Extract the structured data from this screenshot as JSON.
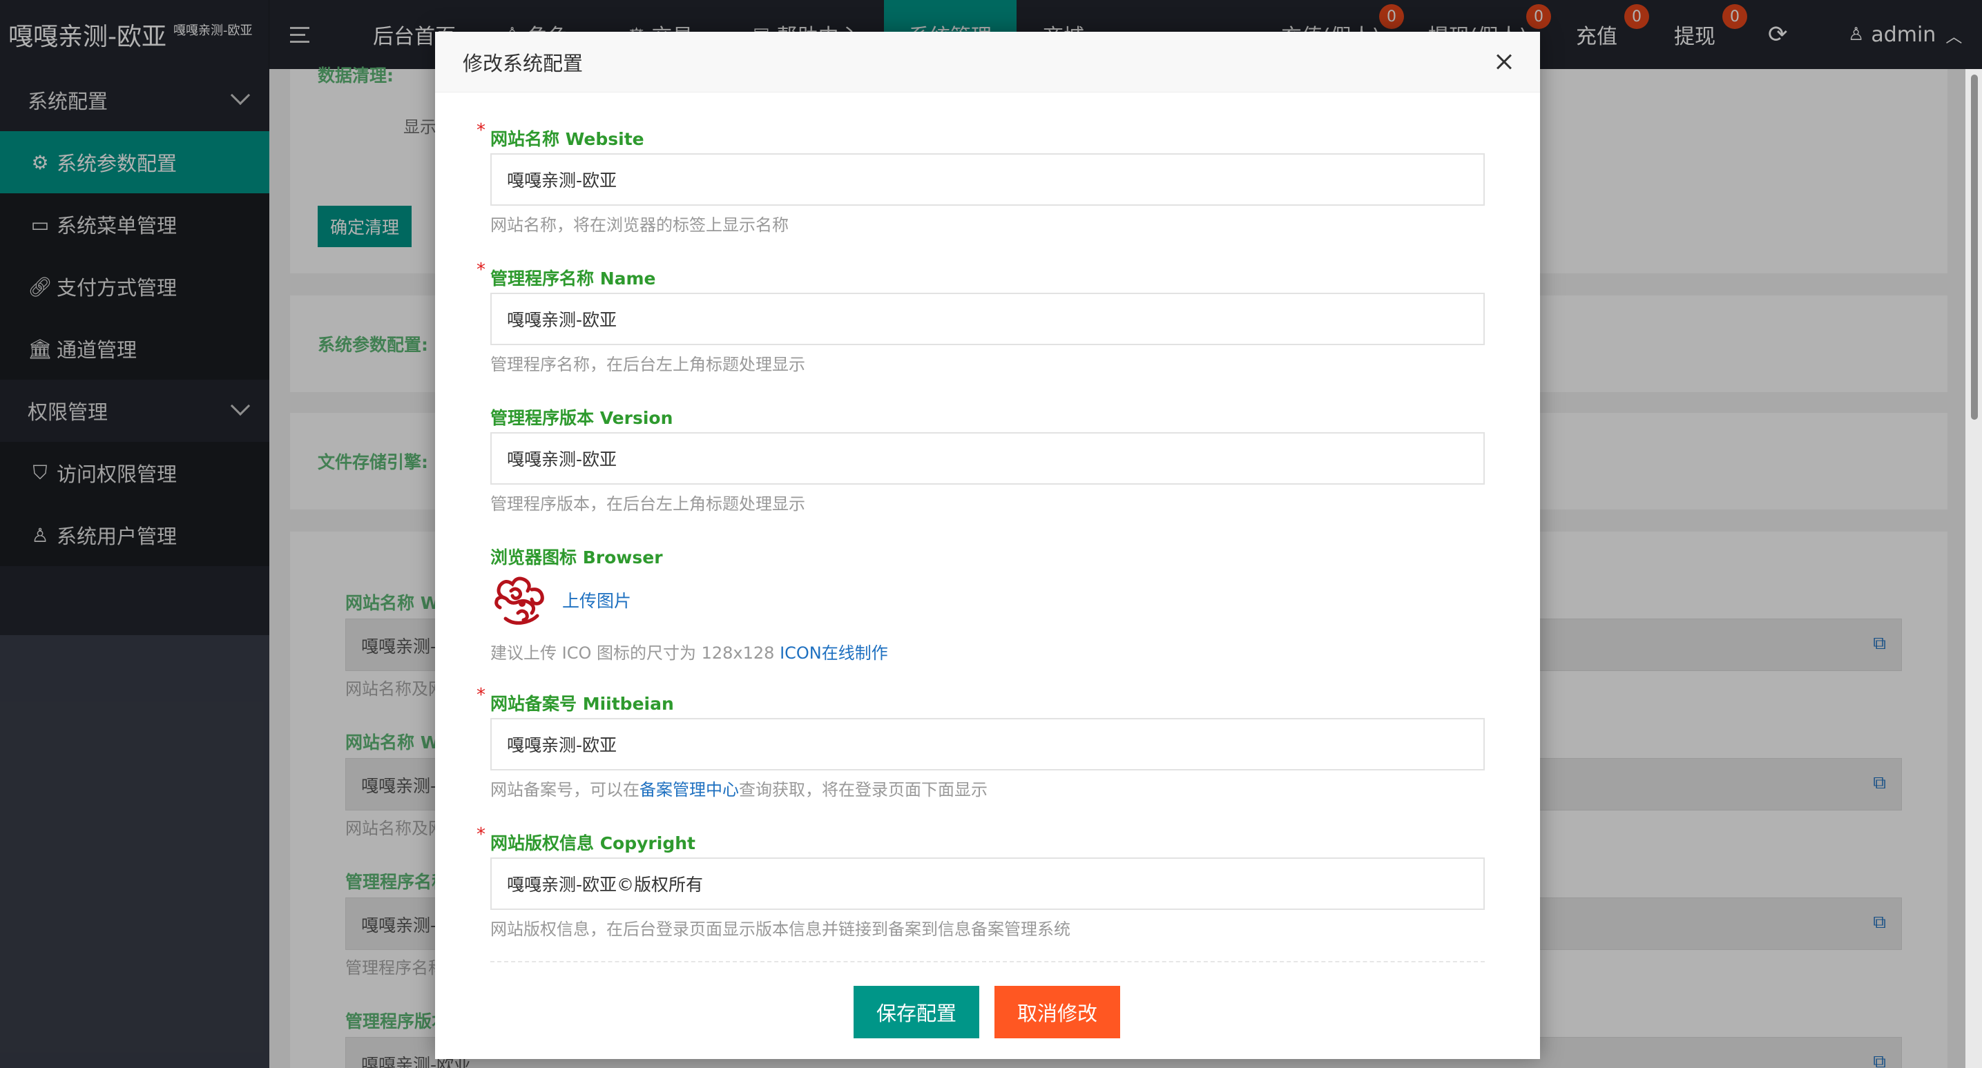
{
  "brand": {
    "title": "嘎嘎亲测-欧亚",
    "subtitle": "嘎嘎亲测-欧亚"
  },
  "topnav": {
    "items": [
      "后台首页",
      "角色",
      "交易",
      "帮助中心",
      "系统管理",
      "商城"
    ],
    "right_items": [
      {
        "label": "充值(假人)",
        "badge": "0"
      },
      {
        "label": "提现(假人)",
        "badge": "0"
      },
      {
        "label": "充值",
        "badge": "0"
      },
      {
        "label": "提现",
        "badge": "0"
      }
    ],
    "user": "admin"
  },
  "sidebar": {
    "items": [
      {
        "label": "系统配置",
        "type": "group"
      },
      {
        "label": "系统参数配置",
        "type": "sub",
        "selected": true
      },
      {
        "label": "系统菜单管理",
        "type": "sub"
      },
      {
        "label": "支付方式管理",
        "type": "sub"
      },
      {
        "label": "通道管理",
        "type": "sub"
      },
      {
        "label": "权限管理",
        "type": "group"
      },
      {
        "label": "访问权限管理",
        "type": "sub"
      },
      {
        "label": "系统用户管理",
        "type": "sub"
      }
    ]
  },
  "background": {
    "data_clear_label": "数据清理:",
    "show_label": "显示",
    "confirm_clear_button": "确定清理",
    "sys_param_label": "系统参数配置:",
    "file_storage_label": "文件存储引擎:",
    "rows": [
      {
        "label": "网站名称 W",
        "value": "嘎嘎亲测-",
        "help": "网站名称及网"
      },
      {
        "label": "网站名称 W",
        "value": "嘎嘎亲测-",
        "help": "网站名称及网"
      },
      {
        "label": "管理程序名称",
        "value": "嘎嘎亲测-",
        "help": "管理程序名称"
      },
      {
        "label": "管理程序版本",
        "value": "嘎嘎亲测-欧亚",
        "help": ""
      }
    ]
  },
  "modal": {
    "title": "修改系统配置",
    "fields": {
      "website": {
        "label": "网站名称 Website",
        "value": "嘎嘎亲测-欧亚",
        "help": "网站名称，将在浏览器的标签上显示名称"
      },
      "name": {
        "label": "管理程序名称 Name",
        "value": "嘎嘎亲测-欧亚",
        "help": "管理程序名称，在后台左上角标题处理显示"
      },
      "version": {
        "label": "管理程序版本 Version",
        "value": "嘎嘎亲测-欧亚",
        "help": "管理程序版本，在后台左上角标题处理显示"
      },
      "browser": {
        "label": "浏览器图标 Browser",
        "upload": "上传图片",
        "help_prefix": "建议上传 ICO 图标的尺寸为 128x128 ",
        "help_link": "ICON在线制作"
      },
      "miitbeian": {
        "label": "网站备案号 Miitbeian",
        "value": "嘎嘎亲测-欧亚",
        "help_prefix": "网站备案号，可以在",
        "help_link": "备案管理中心",
        "help_suffix": "查询获取，将在登录页面下面显示"
      },
      "copyright": {
        "label": "网站版权信息 Copyright",
        "value": "嘎嘎亲测-欧亚©版权所有",
        "help": "网站版权信息，在后台登录页面显示版本信息并链接到备案到信息备案管理系统"
      }
    },
    "save_button": "保存配置",
    "cancel_button": "取消修改"
  },
  "colors": {
    "accent": "#009688",
    "danger": "#ff5722",
    "label_green": "#2e9a2e",
    "link": "#1e70c0",
    "sidebar_bg": "#23262e"
  },
  "icons": [
    "menu-icon",
    "gear-icon",
    "table-icon",
    "link-icon",
    "bank-icon",
    "shield-icon",
    "user-icon",
    "refresh-icon",
    "close-icon",
    "copy-icon"
  ]
}
